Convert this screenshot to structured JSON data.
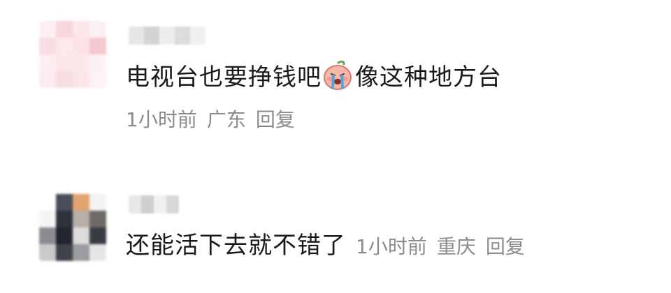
{
  "comments": [
    {
      "text_before_emoji": "电视台也要挣钱吧",
      "emoji": "crying-peach-emoji",
      "text_after_emoji": "像这种地方台",
      "time": "1小时前",
      "location": "广东",
      "reply_label": "回复"
    },
    {
      "text": "还能活下去就不错了",
      "time": "1小时前",
      "location": "重庆",
      "reply_label": "回复"
    }
  ],
  "colors": {
    "text": "#1a1a1a",
    "meta": "#8c8c8c",
    "background": "#ffffff"
  }
}
